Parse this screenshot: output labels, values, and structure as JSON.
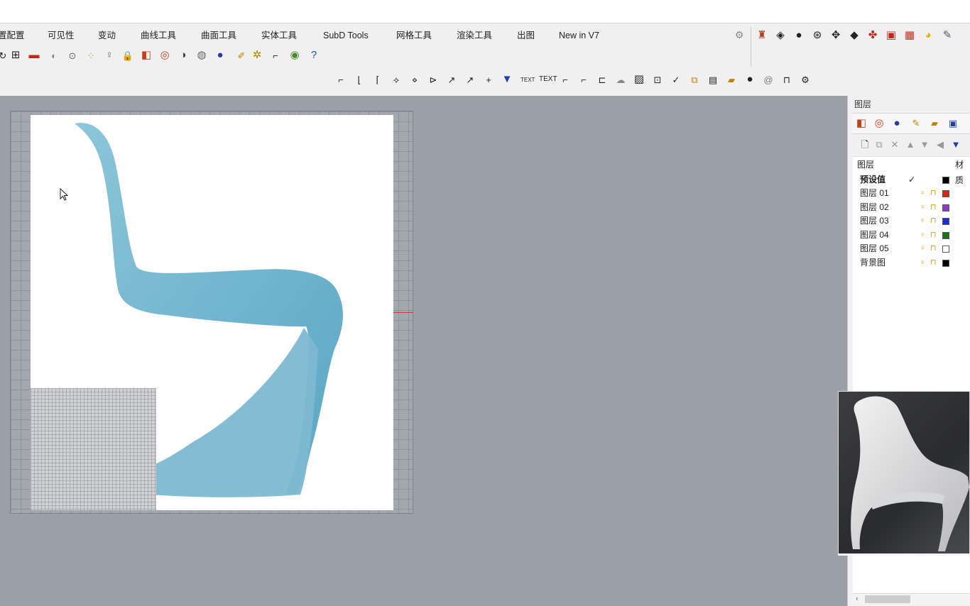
{
  "tabs": [
    {
      "label": "置配置"
    },
    {
      "label": "可见性"
    },
    {
      "label": "变动"
    },
    {
      "label": "曲线工具"
    },
    {
      "label": "曲面工具"
    },
    {
      "label": "实体工具"
    },
    {
      "label": "SubD Tools"
    },
    {
      "label": "网格工具"
    },
    {
      "label": "渲染工具"
    },
    {
      "label": "出图"
    },
    {
      "label": "New in V7"
    }
  ],
  "toolbar2_text": {
    "text1": "TEXT",
    "text2": "TEXT"
  },
  "panel": {
    "title": "图层",
    "columns": {
      "layer": "图层",
      "material": "材质"
    },
    "layers": [
      {
        "name": "预设值",
        "current": "✓",
        "color": "#000000"
      },
      {
        "name": "图层 01",
        "current": "",
        "color": "#d0281c"
      },
      {
        "name": "图层 02",
        "current": "",
        "color": "#8a3cc9"
      },
      {
        "name": "图层 03",
        "current": "",
        "color": "#1f2fd6"
      },
      {
        "name": "图层 04",
        "current": "",
        "color": "#16721f"
      },
      {
        "name": "图层 05",
        "current": "",
        "color": "#ffffff"
      },
      {
        "name": "背景图",
        "current": "",
        "color": "#000000"
      }
    ]
  },
  "colors": {
    "viewport_bg": "#9ba0a8",
    "chair_blue": "#7ab8d0",
    "axis_red": "#c63a3a"
  }
}
